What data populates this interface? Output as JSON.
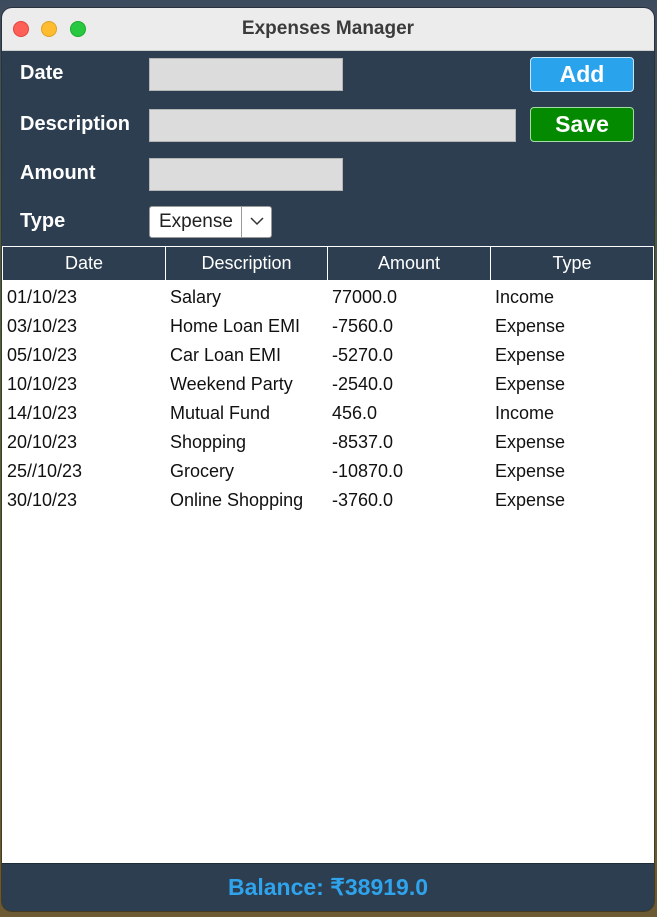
{
  "window": {
    "title": "Expenses Manager"
  },
  "form": {
    "date_label": "Date",
    "description_label": "Description",
    "amount_label": "Amount",
    "type_label": "Type",
    "date_value": "",
    "description_value": "",
    "amount_value": "",
    "type_selected": "Expense"
  },
  "buttons": {
    "add_label": "Add",
    "save_label": "Save"
  },
  "table": {
    "columns": [
      "Date",
      "Description",
      "Amount",
      "Type"
    ],
    "rows": [
      [
        "01/10/23",
        "Salary",
        "77000.0",
        "Income"
      ],
      [
        "03/10/23",
        "Home Loan EMI",
        "-7560.0",
        "Expense"
      ],
      [
        "05/10/23",
        "Car Loan EMI",
        "-5270.0",
        "Expense"
      ],
      [
        "10/10/23",
        "Weekend Party",
        "-2540.0",
        "Expense"
      ],
      [
        "14/10/23",
        "Mutual Fund",
        "456.0",
        "Income"
      ],
      [
        "20/10/23",
        "Shopping",
        "-8537.0",
        "Expense"
      ],
      [
        "25//10/23",
        "Grocery",
        "-10870.0",
        "Expense"
      ],
      [
        "30/10/23",
        "Online Shopping",
        "-3760.0",
        "Expense"
      ]
    ]
  },
  "footer": {
    "balance_text": "Balance: ₹38919.0"
  },
  "colors": {
    "panel_bg": "#2c3e50",
    "add_button": "#29a3ec",
    "save_button": "#038a00",
    "balance_text": "#2fa3ec"
  },
  "icons": {
    "type_dropdown": "chevron-down-icon"
  }
}
